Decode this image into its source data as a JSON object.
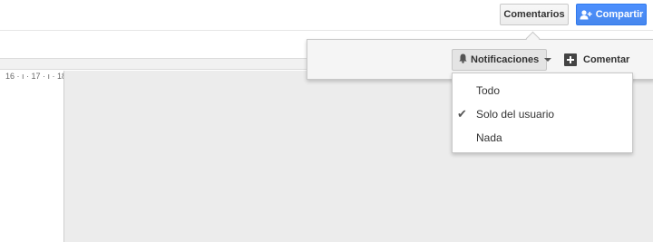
{
  "header": {
    "comments_label": "Comentarios",
    "share_label": "Compartir"
  },
  "ruler": {
    "text": "16 · ı · 17 · ı · 18"
  },
  "comments_panel": {
    "notifications_label": "Notificaciones",
    "comment_label": "Comentar"
  },
  "notifications_menu": {
    "items": [
      {
        "label": "Todo",
        "checked": false
      },
      {
        "label": "Solo del usuario",
        "checked": true
      },
      {
        "label": "Nada",
        "checked": false
      }
    ]
  },
  "colors": {
    "share_button": "#4d90fe",
    "document_background": "#ececec",
    "panel_background": "#f5f5f5"
  }
}
